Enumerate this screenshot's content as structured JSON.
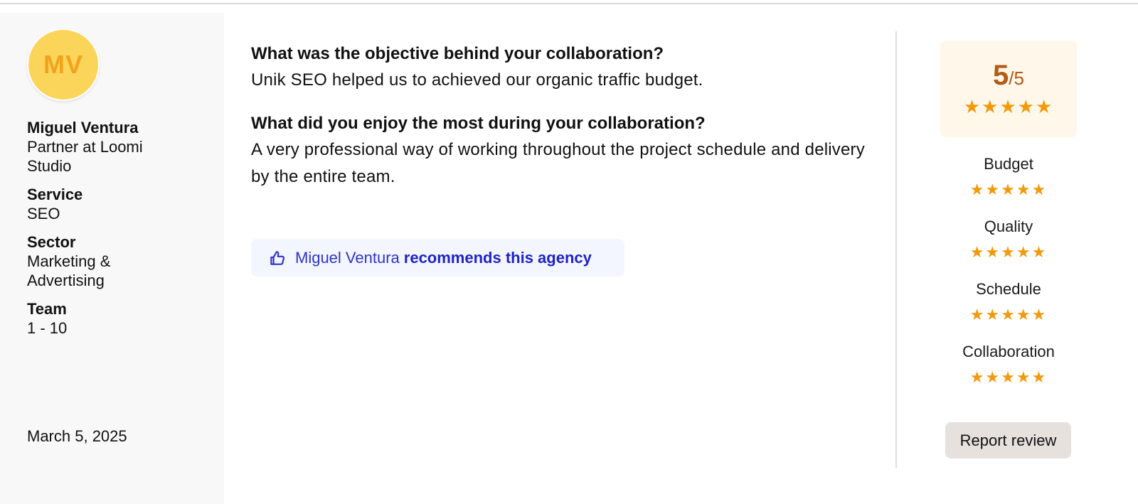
{
  "reviewer": {
    "initials": "MV",
    "name": "Miguel Ventura",
    "role": "Partner at Loomi Studio",
    "fields": [
      {
        "label": "Service",
        "value": "SEO"
      },
      {
        "label": "Sector",
        "value": "Marketing & Advertising"
      },
      {
        "label": "Team",
        "value": "1 - 10"
      }
    ],
    "date": "March 5, 2025",
    "avatar_color": "#fbd55a"
  },
  "review": {
    "qa": [
      {
        "question": "What was the objective behind your collaboration?",
        "answer": "Unik SEO helped us to achieved our organic traffic budget."
      },
      {
        "question": "What did you enjoy the most during your collaboration?",
        "answer": "A very professional way of working throughout the project schedule and delivery by the entire team."
      }
    ],
    "recommendation": {
      "icon": "thumbs-up-icon",
      "name": "Miguel Ventura",
      "text": "recommends this agency"
    }
  },
  "rating": {
    "score": "5",
    "out_of": "/5",
    "stars": "★★★★★",
    "star_value": 5,
    "criteria": [
      {
        "label": "Budget",
        "stars": "★★★★★",
        "value": 5
      },
      {
        "label": "Quality",
        "stars": "★★★★★",
        "value": 5
      },
      {
        "label": "Schedule",
        "stars": "★★★★★",
        "value": 5
      },
      {
        "label": "Collaboration",
        "stars": "★★★★★",
        "value": 5
      }
    ],
    "star_color": "#f29a0c",
    "score_color": "#b35a16"
  },
  "actions": {
    "report_label": "Report review"
  }
}
